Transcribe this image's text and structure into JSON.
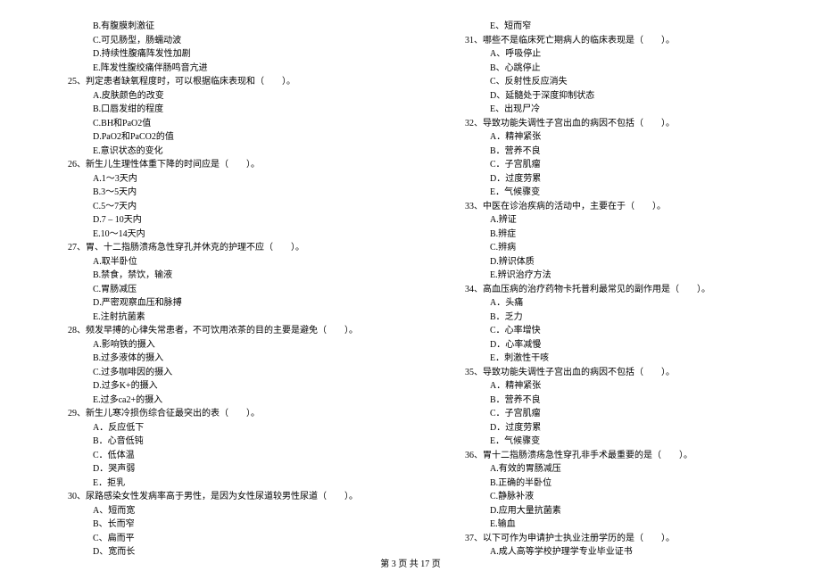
{
  "left": [
    {
      "cls": "option",
      "text": "B.有腹膜刺激征"
    },
    {
      "cls": "option",
      "text": "C.可见肠型，肠蠕动波"
    },
    {
      "cls": "option",
      "text": "D.持续性腹痛阵发性加剧"
    },
    {
      "cls": "option",
      "text": "E.阵发性腹绞痛伴肠鸣音亢进"
    },
    {
      "cls": "question",
      "text": "25、判定患者缺氧程度时，可以根据临床表现和（　　）。"
    },
    {
      "cls": "option",
      "text": "A.皮肤颜色的改变"
    },
    {
      "cls": "option",
      "text": "B.口唇发绀的程度"
    },
    {
      "cls": "option",
      "text": "C.BH和PaO2值"
    },
    {
      "cls": "option",
      "text": "D.PaO2和PaCO2的值"
    },
    {
      "cls": "option",
      "text": "E.意识状态的变化"
    },
    {
      "cls": "question",
      "text": "26、新生儿生理性体重下降的时间应是（　　）。"
    },
    {
      "cls": "option",
      "text": "A.1～3天内"
    },
    {
      "cls": "option",
      "text": "B.3～5天内"
    },
    {
      "cls": "option",
      "text": "C.5～7天内"
    },
    {
      "cls": "option",
      "text": "D.7 – 10天内"
    },
    {
      "cls": "option",
      "text": "E.10～14天内"
    },
    {
      "cls": "question",
      "text": "27、胃、十二指肠溃疡急性穿孔并休克的护理不应（　　）。"
    },
    {
      "cls": "option",
      "text": "A.取半卧位"
    },
    {
      "cls": "option",
      "text": "B.禁食，禁饮，输液"
    },
    {
      "cls": "option",
      "text": "C.胃肠减压"
    },
    {
      "cls": "option",
      "text": "D.严密观察血压和脉搏"
    },
    {
      "cls": "option",
      "text": "E.注射抗菌素"
    },
    {
      "cls": "question",
      "text": "28、频发早搏的心律失常患者，不可饮用浓茶的目的主要是避免（　　）。"
    },
    {
      "cls": "option",
      "text": "A.影响铁的摄入"
    },
    {
      "cls": "option",
      "text": "B.过多液体的摄入"
    },
    {
      "cls": "option",
      "text": "C.过多咖啡因的摄入"
    },
    {
      "cls": "option",
      "text": "D.过多K+的摄入"
    },
    {
      "cls": "option",
      "text": "E.过多ca2+的摄入"
    },
    {
      "cls": "question",
      "text": "29、新生儿寒冷损伤综合征最突出的表（　　）。"
    },
    {
      "cls": "option",
      "text": "A．反应低下"
    },
    {
      "cls": "option",
      "text": "B．心音低钝"
    },
    {
      "cls": "option",
      "text": "C．低体温"
    },
    {
      "cls": "option",
      "text": "D．哭声弱"
    },
    {
      "cls": "option",
      "text": "E．拒乳"
    },
    {
      "cls": "question",
      "text": "30、尿路感染女性发病率高于男性，是因为女性尿道较男性尿道（　　）。"
    },
    {
      "cls": "option",
      "text": "A、短而宽"
    },
    {
      "cls": "option",
      "text": "B、长而窄"
    },
    {
      "cls": "option",
      "text": "C、扁而平"
    },
    {
      "cls": "option",
      "text": "D、宽而长"
    }
  ],
  "right": [
    {
      "cls": "option",
      "text": "E、短而窄"
    },
    {
      "cls": "question",
      "text": "31、哪些不是临床死亡期病人的临床表现是（　　）。"
    },
    {
      "cls": "option",
      "text": "A、呼吸停止"
    },
    {
      "cls": "option",
      "text": "B、心跳停止"
    },
    {
      "cls": "option",
      "text": "C、反射性反应消失"
    },
    {
      "cls": "option",
      "text": "D、延髓处于深度抑制状态"
    },
    {
      "cls": "option",
      "text": "E、出现尸冷"
    },
    {
      "cls": "question",
      "text": "32、导致功能失调性子宫出血的病因不包括（　　）。"
    },
    {
      "cls": "option",
      "text": "A．精神紧张"
    },
    {
      "cls": "option",
      "text": "B．营养不良"
    },
    {
      "cls": "option",
      "text": "C．子宫肌瘤"
    },
    {
      "cls": "option",
      "text": "D．过度劳累"
    },
    {
      "cls": "option",
      "text": "E．气候骤变"
    },
    {
      "cls": "question",
      "text": "33、中医在诊治疾病的活动中，主要在于（　　）。"
    },
    {
      "cls": "option",
      "text": "A.辨证"
    },
    {
      "cls": "option",
      "text": "B.辨症"
    },
    {
      "cls": "option",
      "text": "C.辨病"
    },
    {
      "cls": "option",
      "text": "D.辨识体质"
    },
    {
      "cls": "option",
      "text": "E.辨识治疗方法"
    },
    {
      "cls": "question",
      "text": "34、高血压病的治疗药物卡托普利最常见的副作用是（　　）。"
    },
    {
      "cls": "option",
      "text": "A．头痛"
    },
    {
      "cls": "option",
      "text": "B．乏力"
    },
    {
      "cls": "option",
      "text": "C．心率增快"
    },
    {
      "cls": "option",
      "text": "D．心率减慢"
    },
    {
      "cls": "option",
      "text": "E．刺激性干咳"
    },
    {
      "cls": "question",
      "text": "35、导致功能失调性子宫出血的病因不包括（　　）。"
    },
    {
      "cls": "option",
      "text": "A．精神紧张"
    },
    {
      "cls": "option",
      "text": "B．营养不良"
    },
    {
      "cls": "option",
      "text": "C．子宫肌瘤"
    },
    {
      "cls": "option",
      "text": "D．过度劳累"
    },
    {
      "cls": "option",
      "text": "E．气候骤变"
    },
    {
      "cls": "question",
      "text": "36、胃十二指肠溃疡急性穿孔非手术最重要的是（　　）。"
    },
    {
      "cls": "option",
      "text": "A.有效的胃肠减压"
    },
    {
      "cls": "option",
      "text": "B.正确的半卧位"
    },
    {
      "cls": "option",
      "text": "C.静脉补液"
    },
    {
      "cls": "option",
      "text": "D.应用大量抗菌素"
    },
    {
      "cls": "option",
      "text": "E.输血"
    },
    {
      "cls": "question",
      "text": "37、以下可作为申请护士执业注册学历的是（　　）。"
    },
    {
      "cls": "option",
      "text": "A.成人高等学校护理学专业毕业证书"
    }
  ],
  "footer": "第 3 页 共 17 页"
}
